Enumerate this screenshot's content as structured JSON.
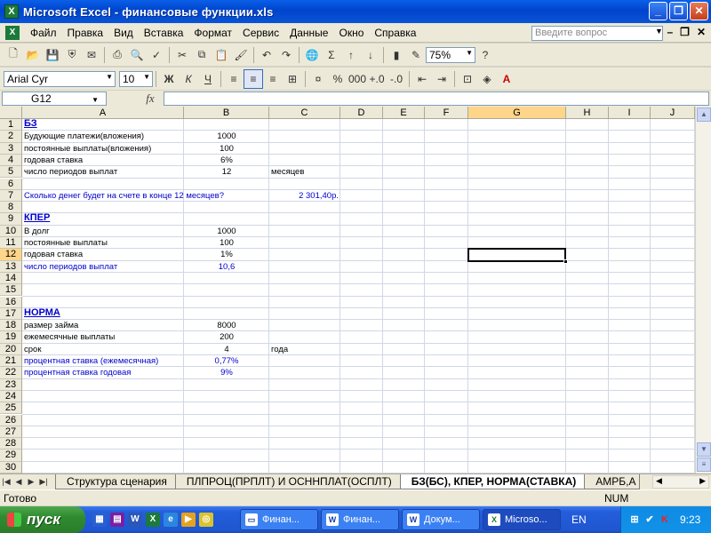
{
  "window": {
    "title": "Microsoft Excel - финансовые функции.xls"
  },
  "menu": [
    "Файл",
    "Правка",
    "Вид",
    "Вставка",
    "Формат",
    "Сервис",
    "Данные",
    "Окно",
    "Справка"
  ],
  "question_placeholder": "Введите вопрос",
  "toolbar": {
    "zoom": "75%"
  },
  "format_toolbar": {
    "font": "Arial Cyr",
    "size": "10"
  },
  "formula_bar": {
    "name_box": "G12",
    "formula": ""
  },
  "columns": [
    "A",
    "B",
    "C",
    "D",
    "E",
    "F",
    "G",
    "H",
    "I",
    "J"
  ],
  "selected": {
    "column": "G",
    "row": 12
  },
  "rows": [
    "1",
    "2",
    "3",
    "4",
    "5",
    "6",
    "7",
    "8",
    "9",
    "10",
    "11",
    "12",
    "13",
    "14",
    "15",
    "16",
    "17",
    "18",
    "19",
    "20",
    "21",
    "22",
    "23",
    "24",
    "25",
    "26",
    "27",
    "28",
    "29",
    "30"
  ],
  "cells": {
    "r1": {
      "a": "БЗ"
    },
    "r2": {
      "a": "Будующие платежи(вложения)",
      "b": "1000"
    },
    "r3": {
      "a": "постоянные выплаты(вложения)",
      "b": "100"
    },
    "r4": {
      "a": "годовая ставка",
      "b": "6%"
    },
    "r5": {
      "a": "число периодов выплат",
      "b": "12",
      "c": "месяцев"
    },
    "r7": {
      "a": "Сколько денег будет на счете в конце 12 месяцев?",
      "c": "2 301,40р."
    },
    "r9": {
      "a": "КПЕР"
    },
    "r10": {
      "a": "В долг",
      "b": "1000"
    },
    "r11": {
      "a": "постоянные выплаты",
      "b": "100"
    },
    "r12": {
      "a": "годовая ставка",
      "b": "1%"
    },
    "r13": {
      "a": "число периодов выплат",
      "b": "10,6"
    },
    "r17": {
      "a": "НОРМА"
    },
    "r18": {
      "a": "размер займа",
      "b": "8000"
    },
    "r19": {
      "a": "ежемесячные выплаты",
      "b": "200"
    },
    "r20": {
      "a": "срок",
      "b": "4",
      "c": "года"
    },
    "r21": {
      "a": "процентная ставка (ежемесячная)",
      "b": "0,77%"
    },
    "r22": {
      "a": "процентная ставка годовая",
      "b": "9%"
    }
  },
  "sheet_tabs": [
    "Структура сценария",
    "ПЛПРОЦ(ПРПЛТ) И ОСННПЛАТ(ОСПЛТ)",
    "БЗ(БС), КПЕР, НОРМА(СТАВКА)",
    "АМРБ,А"
  ],
  "active_sheet": "БЗ(БС), КПЕР, НОРМА(СТАВКА)",
  "status": {
    "left": "Готово",
    "num": "NUM"
  },
  "taskbar": {
    "start": "пуск",
    "tasks": [
      "Финан...",
      "Финан...",
      "Докум...",
      "Microso..."
    ],
    "language": "EN",
    "clock": "9:23"
  }
}
